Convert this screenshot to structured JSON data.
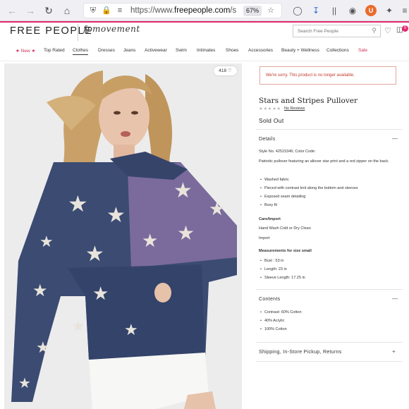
{
  "browser": {
    "url_prefix": "https://www.",
    "url_host": "freepeople.com",
    "url_rest": "/sho",
    "zoom": "67%",
    "extension_badge": "U"
  },
  "header": {
    "logo": "FREE PEOPLE",
    "sub_brand": "fpmovement",
    "search_placeholder": "Search Free People",
    "bag_count": "0"
  },
  "nav": [
    {
      "label": "★ New ★",
      "red": true
    },
    {
      "label": "Top Rated"
    },
    {
      "label": "Clothes",
      "selected": true
    },
    {
      "label": "Dresses"
    },
    {
      "label": "Jeans"
    },
    {
      "label": "Activewear"
    },
    {
      "label": "Swim"
    },
    {
      "label": "Intimates"
    },
    {
      "label": "Shoes"
    },
    {
      "label": "Accessories"
    },
    {
      "label": "Beauty + Wellness"
    },
    {
      "label": "Collections"
    },
    {
      "label": "Sale",
      "red": true
    }
  ],
  "image": {
    "likes": "418"
  },
  "product": {
    "alert": "We're sorry. This product is no longer available.",
    "title": "Stars and Stripes Pullover",
    "reviews_link": "No Reviews",
    "status": "Sold Out",
    "details_heading": "Details",
    "style_line": "Style No. 42515346; Color Code:",
    "description": "Patriotic pullover featuring an allover star print and a red zipper on the back.",
    "features": [
      "Washed fabric",
      "Pieced with contrast knit along the bottom and sleeves",
      "Exposed seam detailing",
      "Boxy fit"
    ],
    "care_heading": "Care/Import",
    "care": "Hand Wash Cold or Dry Clean",
    "import": "Import",
    "measure_heading": "Measurements for size small",
    "measurements": [
      "Bust : 53 in",
      "Length: 23 in",
      "Sleeve Length: 17.25 in"
    ],
    "contents_heading": "Contents",
    "contents": [
      "Contrast: 60% Cotton",
      "40% Acrylic",
      "100% Cotton"
    ],
    "shipping_heading": "Shipping, In-Store Pickup, Returns"
  },
  "colors": {
    "accent": "#e22a6f",
    "alert_text": "#c0392b",
    "navy": "#3b4b72",
    "purple": "#7a6b9c"
  }
}
